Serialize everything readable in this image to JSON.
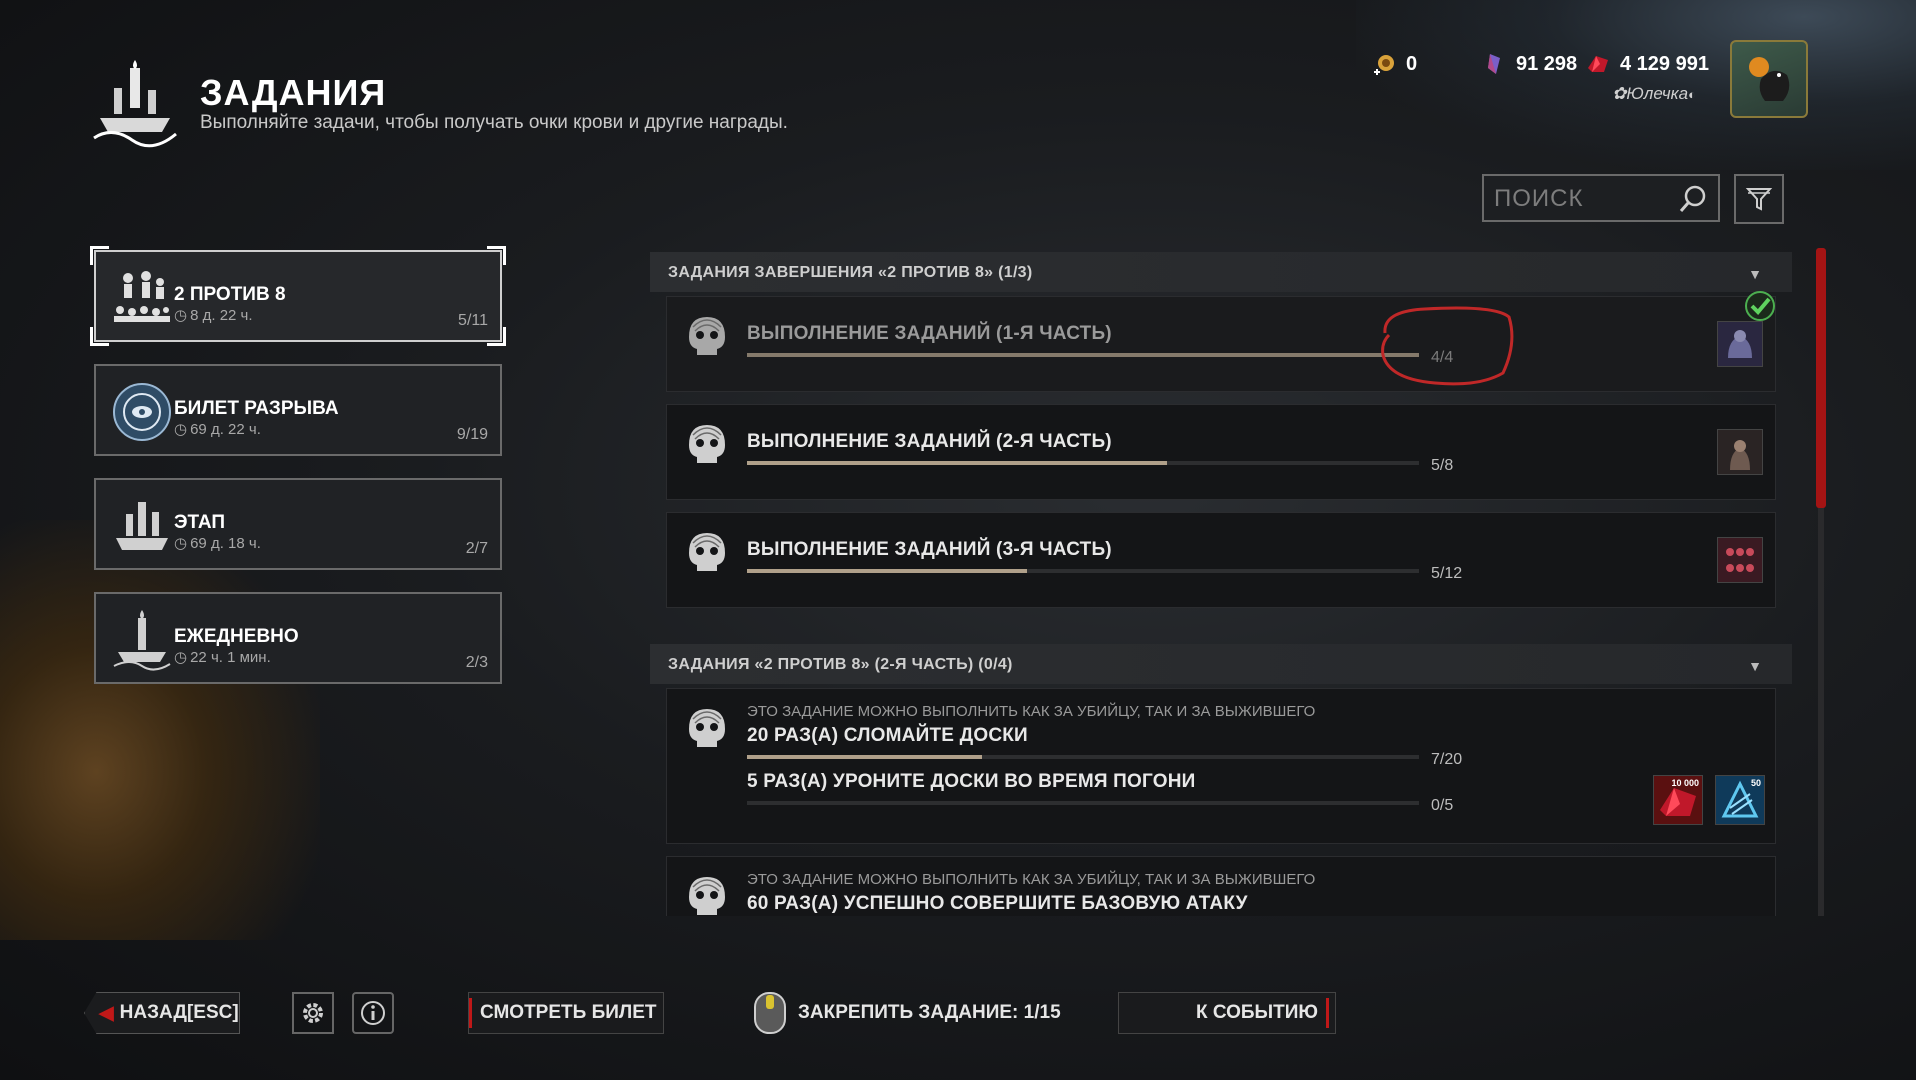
{
  "header": {
    "title": "ЗАДАНИЯ",
    "subtitle": "Выполняйте задачи, чтобы получать очки крови и другие награды."
  },
  "currency": {
    "auric_cells": "0",
    "iridescent_shards": "91 298",
    "bloodpoints": "4 129 991",
    "username": "Юлечка"
  },
  "search": {
    "placeholder": "ПОИСК"
  },
  "categories": [
    {
      "title": "2 ПРОТИВ 8",
      "time": "8 д. 22 ч.",
      "count": "5/11",
      "active": true
    },
    {
      "title": "БИЛЕТ РАЗРЫВА",
      "time": "69 д. 22 ч.",
      "count": "9/19"
    },
    {
      "title": "ЭТАП",
      "time": "69 д. 18 ч.",
      "count": "2/7"
    },
    {
      "title": "ЕЖЕДНЕВНО",
      "time": "22 ч. 1 мин.",
      "count": "2/3"
    }
  ],
  "groups": [
    {
      "title": "ЗАДАНИЯ ЗАВЕРШЕНИЯ «2 ПРОТИВ 8» (1/3)",
      "tasks": [
        {
          "name": "ВЫПОЛНЕНИЕ ЗАДАНИЙ (1-Я ЧАСТЬ)",
          "progress": "4/4",
          "fill": 1.0,
          "completed": true
        },
        {
          "name": "ВЫПОЛНЕНИЕ ЗАДАНИЙ (2-Я ЧАСТЬ)",
          "progress": "5/8",
          "fill": 0.625
        },
        {
          "name": "ВЫПОЛНЕНИЕ ЗАДАНИЙ (3-Я ЧАСТЬ)",
          "progress": "5/12",
          "fill": 0.4167
        }
      ]
    },
    {
      "title": "ЗАДАНИЯ «2 ПРОТИВ 8» (2-Я ЧАСТЬ) (0/4)",
      "tasks": [
        {
          "note": "ЭТО ЗАДАНИЕ МОЖНО ВЫПОЛНИТЬ КАК ЗА УБИЙЦУ, ТАК И ЗА ВЫЖИВШЕГО",
          "name": "20 РАЗ(А) СЛОМАЙТЕ ДОСКИ",
          "progress": "7/20",
          "fill": 0.35,
          "name2": "5 РАЗ(А) УРОНИТЕ ДОСКИ ВО ВРЕМЯ ПОГОНИ",
          "progress2": "0/5",
          "fill2": 0.0,
          "reward1": "10 000",
          "reward2": "50"
        },
        {
          "note": "ЭТО ЗАДАНИЕ МОЖНО ВЫПОЛНИТЬ КАК ЗА УБИЙЦУ, ТАК И ЗА ВЫЖИВШЕГО",
          "name": "60 РАЗ(А) УСПЕШНО СОВЕРШИТЕ БАЗОВУЮ АТАКУ"
        }
      ]
    }
  ],
  "footer": {
    "back": "НАЗАД",
    "back_key": "[ESC]",
    "view_ticket": "СМОТРЕТЬ БИЛЕТ",
    "pin_task": "ЗАКРЕПИТЬ ЗАДАНИЕ: 1/15",
    "to_event": "К СОБЫТИЮ"
  },
  "colors": {
    "accent_red": "#c01818",
    "bar_fill": "#b0a08a",
    "check_green": "#4caf50"
  }
}
